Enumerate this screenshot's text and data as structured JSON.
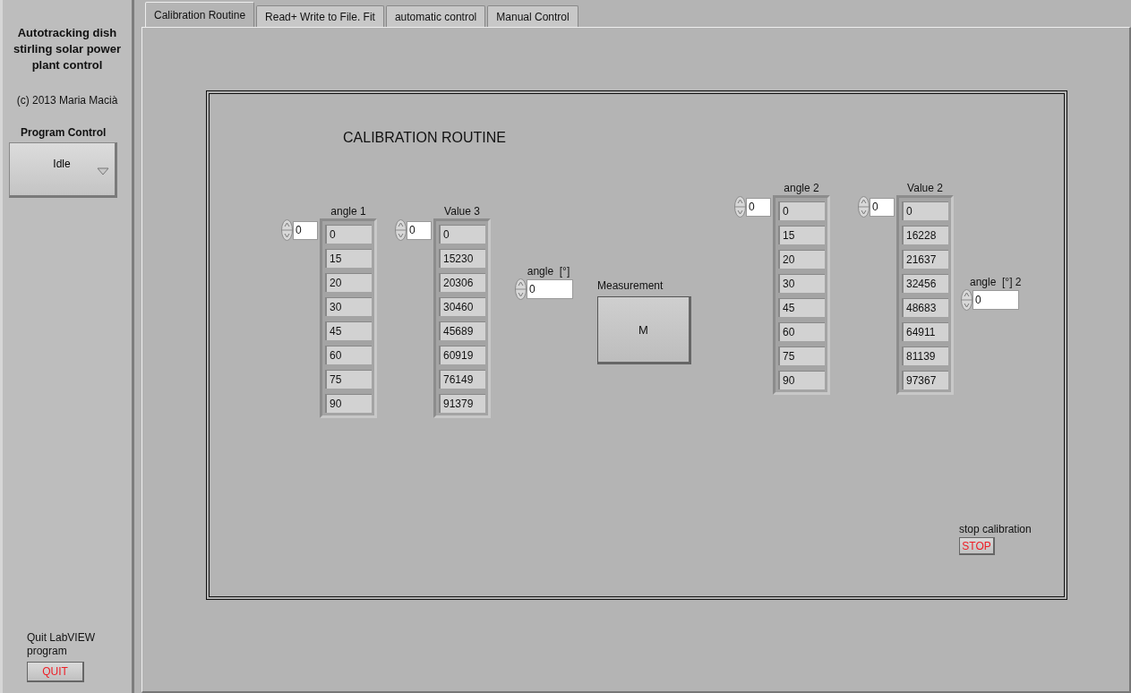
{
  "sidebar": {
    "title": "Autotracking dish stirling solar power plant control",
    "copyright": "(c) 2013 Maria Macià",
    "program_control": {
      "label": "Program Control",
      "value": "Idle"
    },
    "quit": {
      "label": "Quit LabVIEW program",
      "button": "QUIT"
    }
  },
  "tabs": [
    {
      "label": "Calibration Routine",
      "selected": true
    },
    {
      "label": "Read+ Write to File. Fit",
      "selected": false
    },
    {
      "label": "automatic control",
      "selected": false
    },
    {
      "label": "Manual Control",
      "selected": false
    }
  ],
  "panel": {
    "title": "CALIBRATION ROUTINE",
    "arrays": [
      {
        "label": "angle 1",
        "index": "0",
        "values": [
          "0",
          "15",
          "20",
          "30",
          "45",
          "60",
          "75",
          "90"
        ]
      },
      {
        "label": "Value 3",
        "index": "0",
        "values": [
          "0",
          "15230",
          "20306",
          "30460",
          "45689",
          "60919",
          "76149",
          "91379"
        ]
      },
      {
        "label": "angle 2",
        "index": "0",
        "values": [
          "0",
          "15",
          "20",
          "30",
          "45",
          "60",
          "75",
          "90"
        ]
      },
      {
        "label": "Value 2",
        "index": "0",
        "values": [
          "0",
          "16228",
          "21637",
          "32456",
          "48683",
          "64911",
          "81139",
          "97367"
        ]
      }
    ],
    "numerics": [
      {
        "label": "angle  [°]",
        "value": "0"
      },
      {
        "label": "angle  [°] 2",
        "value": "0"
      }
    ],
    "measurement": {
      "label": "Measurement",
      "button": "M"
    },
    "stop": {
      "label": "stop calibration",
      "button": "STOP"
    }
  }
}
